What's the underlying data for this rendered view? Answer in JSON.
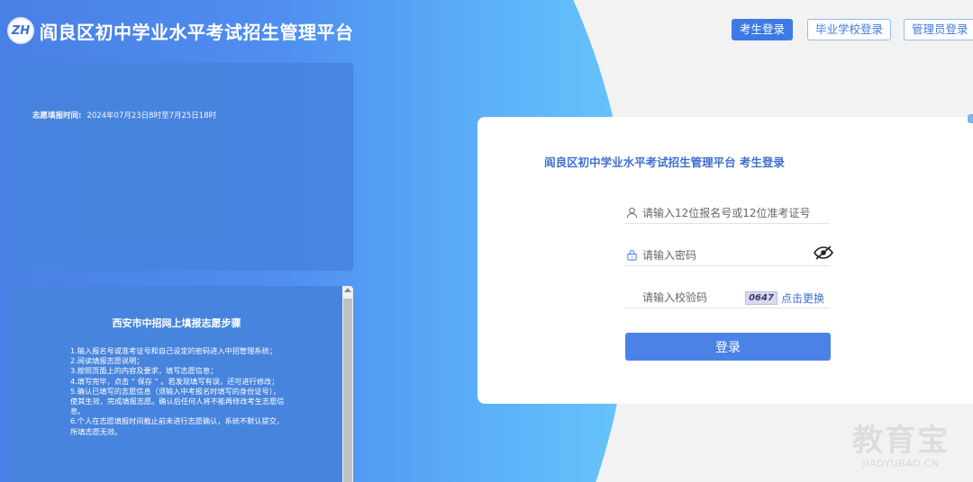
{
  "header": {
    "logo_text": "ZH",
    "title": "阎良区初中学业水平考试招生管理平台"
  },
  "nav": {
    "student_login": "考生登录",
    "school_login": "毕业学校登录",
    "admin_login": "管理员登录"
  },
  "notice": {
    "label": "志愿填报时间:",
    "value": "2024年07月23日8时至7月25日18时"
  },
  "steps": {
    "title": "西安市中招网上填报志愿步骤",
    "lines": [
      "1.输入报名号或准考证号和自己设定的密码进入中招管理系统；",
      "2.阅读填报志愿说明；",
      "3.按照页面上的内容及要求，填写志愿信息；",
      "4.填写完毕，点击 “ 保存 ” 。若发现填写有误，还可进行修改；",
      "5.确认已填写的志愿信息（须输入中考报名时填写的身份证号），使其生效，完成填报志愿。确认后任何人将不能再修改考生志愿信息。",
      " 6.个人在志愿填报时间截止前未进行志愿确认，系统不默认提交，所填志愿无效。"
    ]
  },
  "login": {
    "title": "阎良区初中学业水平考试招生管理平台 考生登录",
    "id_placeholder": "请输入12位报名号或12位准考证号",
    "password_placeholder": "请输入密码",
    "captcha_placeholder": "请输入校验码",
    "captcha_code": "0647",
    "captcha_refresh": "点击更换",
    "submit": "登录"
  },
  "watermark": {
    "brand": "教育宝",
    "url": "JIAOYUBAO.CN"
  },
  "colors": {
    "primary": "#4a82e8",
    "panel": "#4784de",
    "title_text": "#3e6fcf"
  }
}
